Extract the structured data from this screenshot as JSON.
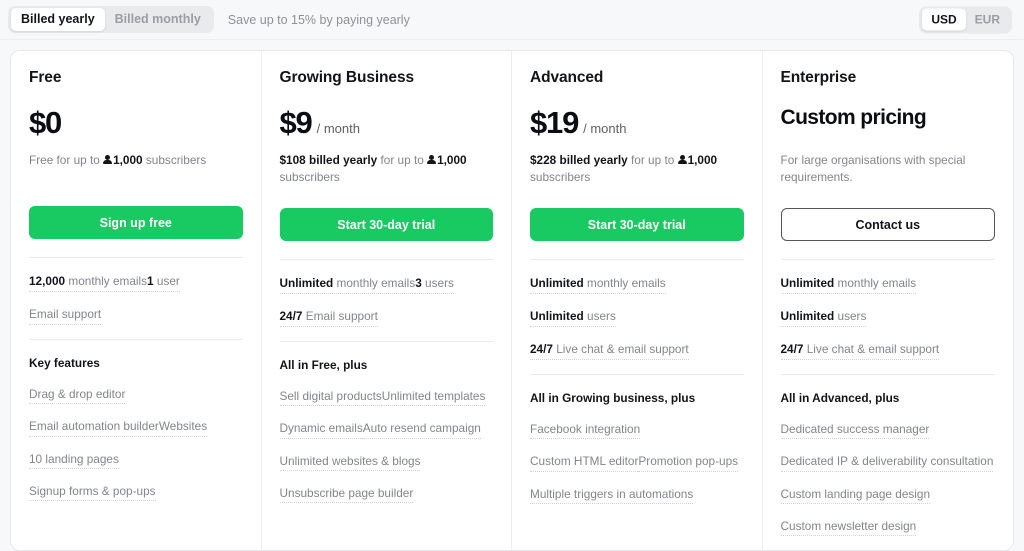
{
  "topbar": {
    "billing_toggle": {
      "options": [
        "Billed yearly",
        "Billed monthly"
      ],
      "selected": "Billed yearly"
    },
    "save_note": "Save up to 15% by paying yearly",
    "currency_toggle": {
      "options": [
        "USD",
        "EUR"
      ],
      "selected": "USD"
    }
  },
  "colors": {
    "accent_green": "#19ca62",
    "page_bg": "#f7f8fa",
    "card_bg": "#ffffff",
    "muted_text": "#82858c"
  },
  "plans": [
    {
      "name": "Free",
      "price": "$0",
      "period": "",
      "sub_prefix": "Free for up to ",
      "sub_icon": "person-icon",
      "sub_bold": "1,000",
      "sub_suffix": " subscribers",
      "cta": "Sign up free",
      "cta_style": "primary",
      "specs": [
        {
          "bold": "12,000",
          "rest": " monthly emails"
        },
        {
          "bold": "1",
          "rest": " user"
        },
        {
          "bold": "",
          "rest": "Email support"
        }
      ],
      "features_head": "Key features",
      "features": [
        "Drag & drop editor",
        "Email automation builder",
        "Websites",
        "10 landing pages",
        "Signup forms & pop-ups"
      ]
    },
    {
      "name": "Growing Business",
      "price": "$9",
      "period": "/ month",
      "sub_prefix": "",
      "sub_lead_bold": "$108 billed yearly",
      "sub_mid": " for up to ",
      "sub_icon": "person-icon",
      "sub_bold": "1,000",
      "sub_suffix": " subscribers",
      "cta": "Start 30-day trial",
      "cta_style": "primary",
      "specs": [
        {
          "bold": "Unlimited",
          "rest": " monthly emails"
        },
        {
          "bold": "3",
          "rest": " users"
        },
        {
          "bold": "24/7",
          "rest": " Email support"
        }
      ],
      "features_head": "All in Free, plus",
      "features": [
        "Sell digital products",
        "Unlimited templates",
        "Dynamic emails",
        "Auto resend campaign",
        "Unlimited websites & blogs",
        "Unsubscribe page builder"
      ]
    },
    {
      "name": "Advanced",
      "price": "$19",
      "period": "/ month",
      "sub_prefix": "",
      "sub_lead_bold": "$228 billed yearly",
      "sub_mid": " for up to ",
      "sub_icon": "person-icon",
      "sub_bold": "1,000",
      "sub_suffix": " subscribers",
      "cta": "Start 30-day trial",
      "cta_style": "primary",
      "specs": [
        {
          "bold": "Unlimited",
          "rest": " monthly emails"
        },
        {
          "bold": "Unlimited",
          "rest": " users"
        },
        {
          "bold": "24/7",
          "rest": " Live chat & email support"
        }
      ],
      "features_head": "All in Growing business, plus",
      "features": [
        "Facebook integration",
        "Custom HTML editor",
        "Promotion pop-ups",
        "Multiple triggers in automations"
      ]
    },
    {
      "name": "Enterprise",
      "price": "Custom pricing",
      "period": "",
      "sub_plain": "For large organisations with special requirements.",
      "cta": "Contact us",
      "cta_style": "outline",
      "specs": [
        {
          "bold": "Unlimited",
          "rest": " monthly emails"
        },
        {
          "bold": "Unlimited",
          "rest": " users"
        },
        {
          "bold": "24/7",
          "rest": " Live chat & email support"
        }
      ],
      "features_head": "All in Advanced, plus",
      "features": [
        "Dedicated success manager",
        "Dedicated IP & deliverability consultation",
        "Custom landing page design",
        "Custom newsletter design"
      ]
    }
  ]
}
